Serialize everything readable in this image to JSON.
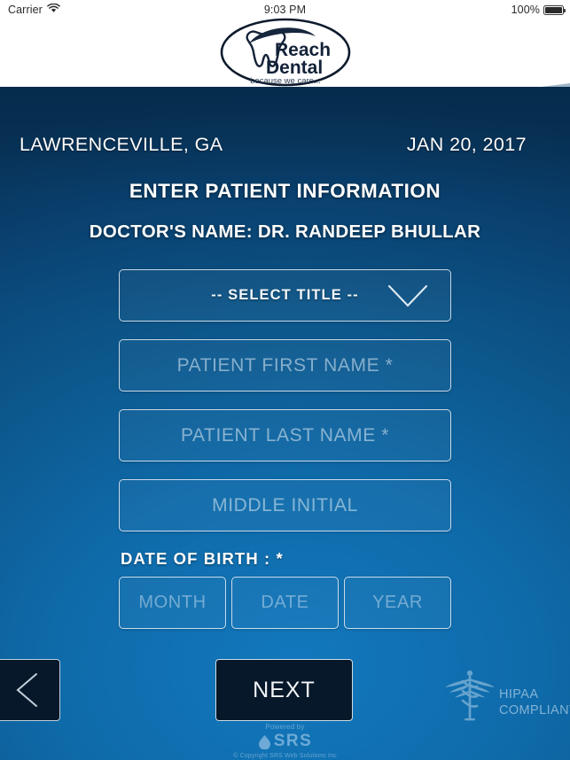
{
  "status_bar": {
    "carrier": "Carrier",
    "wifi_icon": "wifi-icon",
    "time": "9:03 PM",
    "battery_percent": "100%",
    "battery_icon": "battery-full-icon"
  },
  "brand": {
    "logo_name": "reach-dental-logo",
    "line1": "Reach",
    "line2": "Dental",
    "tagline": "because we care..."
  },
  "header": {
    "location": "LAWRENCEVILLE, GA",
    "date": "JAN 20, 2017",
    "form_title": "ENTER PATIENT INFORMATION",
    "doctor_name": "DOCTOR'S NAME: DR. RANDEEP BHULLAR"
  },
  "form": {
    "title_select": {
      "label": "-- SELECT TITLE --",
      "value": "",
      "chevron_icon": "chevron-down-icon"
    },
    "first_name": {
      "placeholder": "PATIENT FIRST NAME *",
      "value": ""
    },
    "last_name": {
      "placeholder": "PATIENT LAST NAME *",
      "value": ""
    },
    "middle_initial": {
      "placeholder": "MIDDLE INITIAL",
      "value": ""
    },
    "dob": {
      "label": "DATE OF BIRTH : *",
      "month": {
        "placeholder": "MONTH",
        "value": ""
      },
      "date": {
        "placeholder": "DATE",
        "value": ""
      },
      "year": {
        "placeholder": "YEAR",
        "value": ""
      }
    }
  },
  "actions": {
    "back_label": "",
    "back_icon": "chevron-left-icon",
    "next_label": "NEXT"
  },
  "hipaa": {
    "icon": "caduceus-icon",
    "line1": "HIPAA",
    "line2": "COMPLIANT"
  },
  "footer": {
    "powered_by": "Powered by",
    "brand": "SRS",
    "logo_icon": "srs-drop-icon",
    "copyright": "© Copyright SRS Web Solutions Inc"
  },
  "colors": {
    "accent_blue": "#1278bd",
    "deep_navy": "#08375f",
    "button_dark": "#07182a",
    "wave_light": "#9cb4c4",
    "wave_dark": "#11486d",
    "field_border": "#e9f0f7"
  }
}
